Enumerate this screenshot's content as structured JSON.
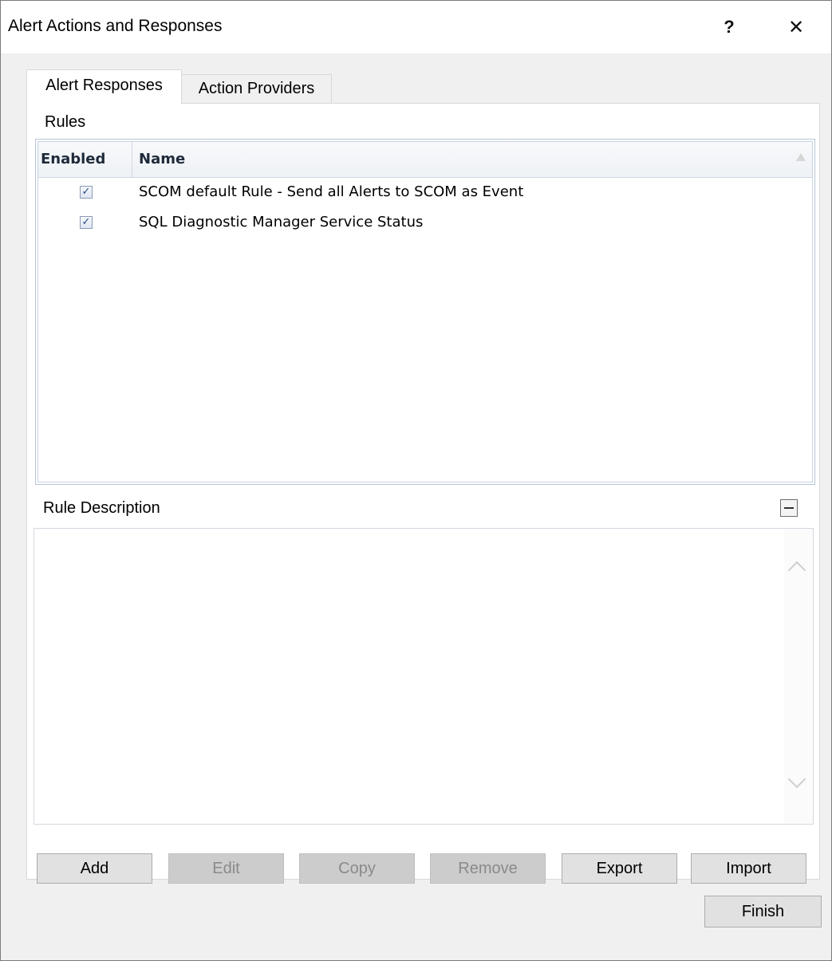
{
  "window": {
    "title": "Alert Actions and Responses",
    "help_label": "?",
    "close_label": "✕"
  },
  "tabs": [
    {
      "label": "Alert Responses",
      "active": true
    },
    {
      "label": "Action Providers",
      "active": false
    }
  ],
  "rules": {
    "label": "Rules",
    "columns": {
      "enabled": "Enabled",
      "name": "Name"
    },
    "items": [
      {
        "enabled": true,
        "name": "SCOM default Rule - Send all Alerts to SCOM as Event"
      },
      {
        "enabled": true,
        "name": "SQL Diagnostic Manager Service Status"
      }
    ]
  },
  "rule_description": {
    "label": "Rule Description",
    "text": ""
  },
  "buttons": {
    "add": "Add",
    "edit": "Edit",
    "copy": "Copy",
    "remove": "Remove",
    "export": "Export",
    "import": "Import",
    "finish": "Finish"
  },
  "colors": {
    "window_bg": "#f0f0f0",
    "panel_bg": "#ffffff",
    "button_bg": "#e1e1e1",
    "disabled_text": "#8a8a8a"
  }
}
